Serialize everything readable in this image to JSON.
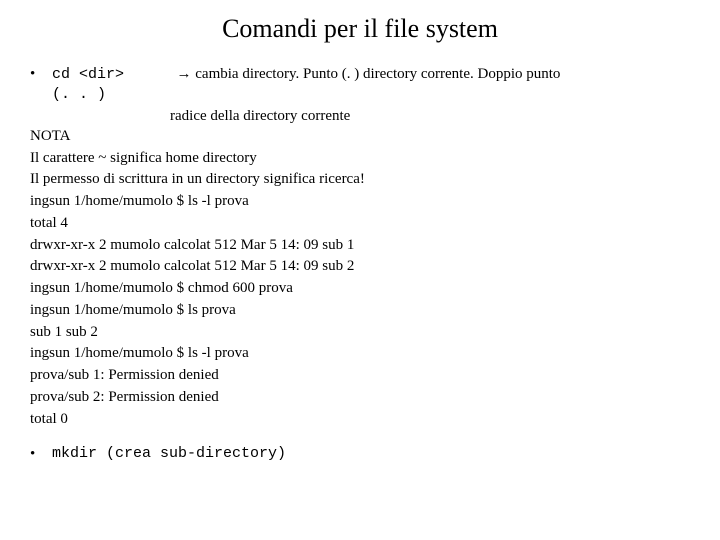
{
  "title": "Comandi per il file system",
  "bullet1": {
    "cmd": "cd <dir>",
    "arrow": "→",
    "desc": "cambia directory. Punto (. ) directory corrente. Doppio punto",
    "line2": "(. . )",
    "radice": "radice della directory corrente"
  },
  "nota": {
    "label": "NOTA",
    "line1": "Il carattere ~ significa home directory",
    "line2": "Il permesso di scrittura in un directory significa ricerca!"
  },
  "term": {
    "l1": "ingsun 1/home/mumolo $ ls -l prova",
    "l2": "total 4",
    "l3": "drwxr-xr-x 2 mumolo calcolat 512 Mar 5 14: 09 sub 1",
    "l4": "drwxr-xr-x 2 mumolo calcolat 512 Mar 5 14: 09 sub 2",
    "l5": "ingsun 1/home/mumolo $ chmod 600 prova",
    "l6": "ingsun 1/home/mumolo $ ls prova",
    "l7": "sub 1 sub 2",
    "l8": "ingsun 1/home/mumolo $ ls -l prova",
    "l9": "prova/sub 1: Permission denied",
    "l10": "prova/sub 2: Permission denied",
    "l11": "total 0"
  },
  "bullet2": {
    "cmd": "mkdir (crea sub-directory)"
  }
}
